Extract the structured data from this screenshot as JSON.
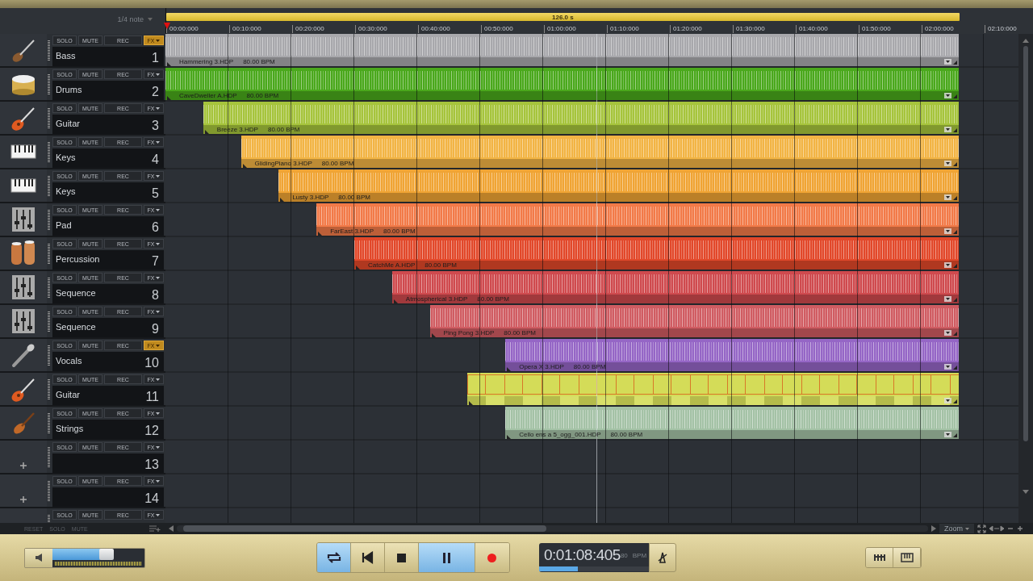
{
  "ruler": {
    "snap": "1/4 note",
    "loop_length": "126.0 s",
    "ticks": [
      "00:00:000",
      "00:10:000",
      "00:20:000",
      "00:30:000",
      "00:40:000",
      "00:50:000",
      "01:00:000",
      "01:10:000",
      "01:20:000",
      "01:30:000",
      "01:40:000",
      "01:50:000",
      "02:00:000",
      "02:10:000"
    ]
  },
  "tracks": [
    {
      "kind": "bass",
      "name": "Bass",
      "number": "1",
      "buttons": [
        "SOLO",
        "MUTE",
        "REC",
        "FX"
      ],
      "fx_selected": true,
      "clip": {
        "kind": "audio",
        "color": "#a8a8ac",
        "title": "Hammering 3.HDP",
        "tempo": "80.00 BPM"
      }
    },
    {
      "kind": "drums",
      "name": "Drums",
      "number": "2",
      "buttons": [
        "SOLO",
        "MUTE",
        "REC",
        "FX"
      ],
      "fx_selected": false,
      "clip": {
        "kind": "audio",
        "color": "#4aa81c",
        "title": "CaveDweller A.HDP",
        "tempo": "80.00 BPM"
      }
    },
    {
      "kind": "guitar",
      "name": "Guitar",
      "number": "3",
      "buttons": [
        "SOLO",
        "MUTE",
        "REC",
        "FX"
      ],
      "fx_selected": false,
      "clip": {
        "kind": "audio",
        "color": "#a6c43c",
        "title": "Breeze 3.HDP",
        "tempo": "80.00 BPM"
      }
    },
    {
      "kind": "keys",
      "name": "Keys",
      "number": "4",
      "buttons": [
        "SOLO",
        "MUTE",
        "REC",
        "FX"
      ],
      "fx_selected": false,
      "clip": {
        "kind": "audio",
        "color": "#f2b444",
        "title": "GlidingPiano 3.HDP",
        "tempo": "80.00 BPM"
      }
    },
    {
      "kind": "keys",
      "name": "Keys",
      "number": "5",
      "buttons": [
        "SOLO",
        "MUTE",
        "REC",
        "FX"
      ],
      "fx_selected": false,
      "clip": {
        "kind": "audio",
        "color": "#f0a434",
        "title": "Lusty 3.HDP",
        "tempo": "80.00 BPM"
      }
    },
    {
      "kind": "mixer",
      "name": "Pad",
      "number": "6",
      "buttons": [
        "SOLO",
        "MUTE",
        "REC",
        "FX"
      ],
      "fx_selected": false,
      "clip": {
        "kind": "audio",
        "color": "#f27a48",
        "title": "FarEast 3.HDP",
        "tempo": "80.00 BPM"
      }
    },
    {
      "kind": "congas",
      "name": "Percussion",
      "number": "7",
      "buttons": [
        "SOLO",
        "MUTE",
        "REC",
        "FX"
      ],
      "fx_selected": false,
      "clip": {
        "kind": "audio",
        "color": "#e2482a",
        "title": "CatchMe A.HDP",
        "tempo": "80.00 BPM"
      }
    },
    {
      "kind": "mixer",
      "name": "Sequence",
      "number": "8",
      "buttons": [
        "SOLO",
        "MUTE",
        "REC",
        "FX"
      ],
      "fx_selected": false,
      "clip": {
        "kind": "audio",
        "color": "#cf4a4e",
        "title": "Atmospherical 3.HDP",
        "tempo": "80.00 BPM"
      }
    },
    {
      "kind": "mixer",
      "name": "Sequence",
      "number": "9",
      "buttons": [
        "SOLO",
        "MUTE",
        "REC",
        "FX"
      ],
      "fx_selected": false,
      "clip": {
        "kind": "audio",
        "color": "#d05c62",
        "title": "Ping Pong 3.HDP",
        "tempo": "80.00 BPM"
      }
    },
    {
      "kind": "microphone",
      "name": "Vocals",
      "number": "10",
      "buttons": [
        "SOLO",
        "MUTE",
        "REC",
        "FX"
      ],
      "fx_selected": true,
      "clip": {
        "kind": "audio",
        "color": "#9566c6",
        "title": "Opera X 3.HDP",
        "tempo": "80.00 BPM"
      }
    },
    {
      "kind": "guitar",
      "name": "Guitar",
      "number": "11",
      "buttons": [
        "SOLO",
        "MUTE",
        "REC",
        "FX"
      ],
      "fx_selected": false,
      "clip": {
        "kind": "pattern",
        "color": "#d4dc58"
      }
    },
    {
      "kind": "violin",
      "name": "Strings",
      "number": "12",
      "buttons": [
        "SOLO",
        "MUTE",
        "REC",
        "FX"
      ],
      "fx_selected": false,
      "clip": {
        "kind": "audio",
        "color": "#a4c2a6",
        "title": "Cello ens a 5_ogg_001.HDP",
        "tempo": "80.00 BPM"
      }
    },
    {
      "kind": "add",
      "number": "13",
      "buttons": [
        "SOLO",
        "MUTE",
        "REC",
        "FX"
      ],
      "fx_selected": false
    },
    {
      "kind": "add",
      "number": "14",
      "buttons": [
        "SOLO",
        "MUTE",
        "REC",
        "FX"
      ],
      "fx_selected": false
    },
    {
      "buttons": [
        "SOLO",
        "MUTE",
        "REC",
        "FX"
      ],
      "fx_selected": false
    }
  ],
  "footer": {
    "buttons": [
      "RESET",
      "SOLO",
      "MUTE"
    ],
    "zoom": "Zoom"
  },
  "transport": {
    "volume": {
      "level": 0.6
    },
    "buttons": [
      {
        "kind": "loop",
        "selected": true
      },
      {
        "kind": "previous",
        "selected": false
      },
      {
        "kind": "stop",
        "selected": false
      },
      {
        "kind": "pause",
        "selected": true
      },
      {
        "kind": "record",
        "selected": false
      }
    ],
    "time": "0:01:08:405",
    "tempo": "80",
    "tempo_unit": "BPM",
    "position": {
      "level": 0.35
    },
    "view_buttons": [
      {
        "kind": "mixer"
      },
      {
        "kind": "keyboard"
      }
    ]
  }
}
